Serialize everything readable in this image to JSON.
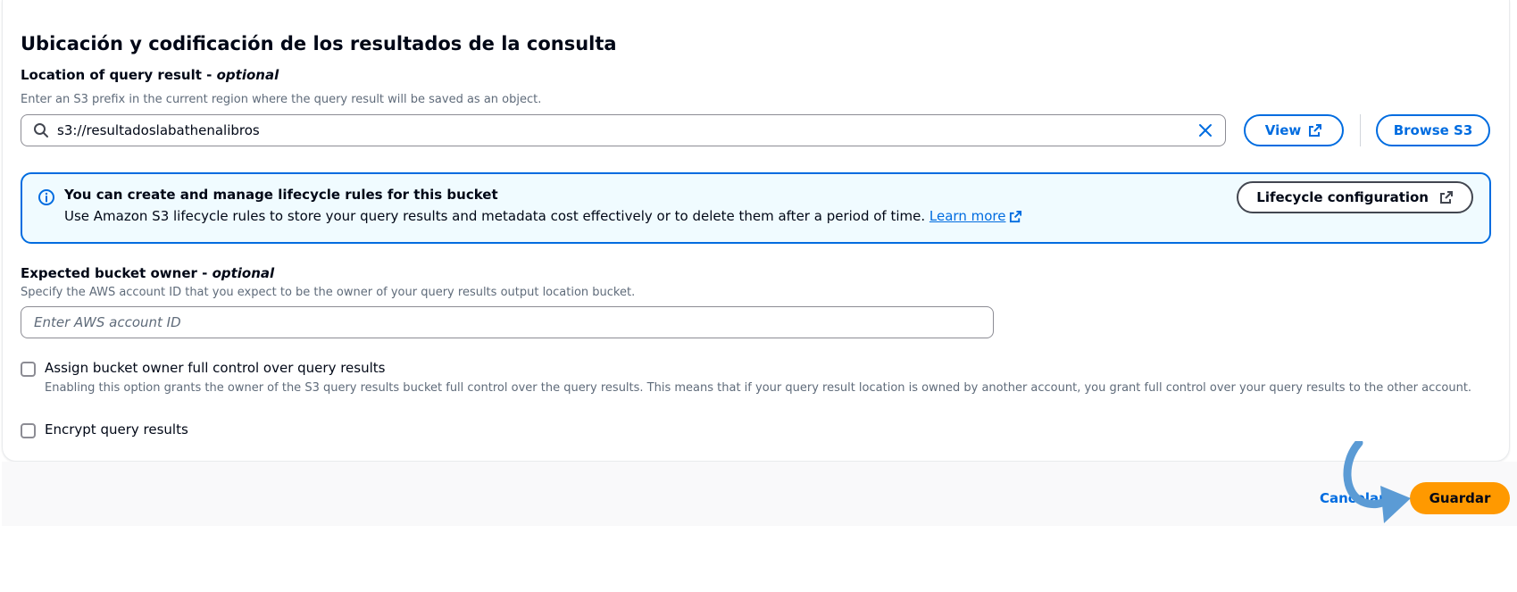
{
  "section": {
    "title": "Ubicación y codificación de los resultados de la consulta"
  },
  "query_result_location": {
    "label": "Location of query result",
    "optional_label": "optional",
    "description": "Enter an S3 prefix in the current region where the query result will be saved as an object.",
    "value": "s3://resultadoslabathenalibros",
    "icons": {
      "search": "search-icon",
      "clear": "clear-icon"
    },
    "view_button": "View",
    "browse_button": "Browse S3"
  },
  "lifecycle_alert": {
    "title": "You can create and manage lifecycle rules for this bucket",
    "body": "Use Amazon S3 lifecycle rules to store your query results and metadata cost effectively or to delete them after a period of time.",
    "link_text": "Learn more",
    "button_label": "Lifecycle configuration",
    "icons": {
      "info": "info-icon",
      "external": "external-link-icon"
    }
  },
  "expected_bucket_owner": {
    "label": "Expected bucket owner",
    "optional_label": "optional",
    "description": "Specify the AWS account ID that you expect to be the owner of your query results output location bucket.",
    "placeholder": "Enter AWS account ID",
    "value": ""
  },
  "assign_full_control": {
    "label": "Assign bucket owner full control over query results",
    "description": "Enabling this option grants the owner of the S3 query results bucket full control over the query results. This means that if your query result location is owned by another account, you grant full control over your query results to the other account.",
    "checked": false
  },
  "encrypt_results": {
    "label": "Encrypt query results",
    "checked": false
  },
  "footer": {
    "cancel_label": "Cancelar",
    "save_label": "Guardar"
  },
  "colors": {
    "primary_button": "#ff9900",
    "link": "#006ce0",
    "alert_background": "#f0fbff",
    "annotation_arrow": "#5b9bd5"
  }
}
